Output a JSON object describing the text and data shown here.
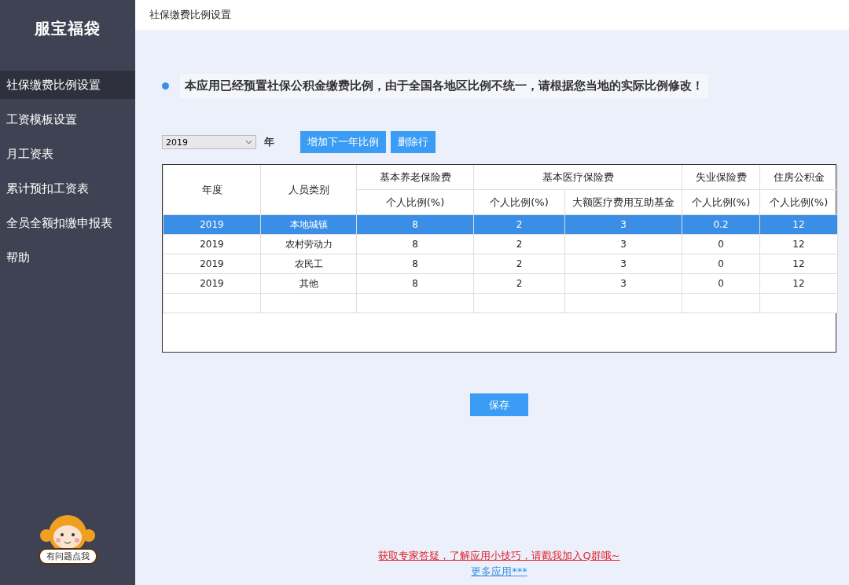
{
  "sidebar": {
    "logo": "服宝福袋",
    "items": [
      {
        "label": "社保缴费比例设置",
        "selected": true
      },
      {
        "label": "工资模板设置",
        "selected": false
      },
      {
        "label": "月工资表",
        "selected": false
      },
      {
        "label": "累计预扣工资表",
        "selected": false
      },
      {
        "label": "全员全额扣缴申报表",
        "selected": false
      },
      {
        "label": "帮助",
        "selected": false
      }
    ],
    "help_badge": "有问题点我"
  },
  "page_title": "社保缴费比例设置",
  "notice": "本应用已经预置社保公积金缴费比例，由于全国各地区比例不统一，请根据您当地的实际比例修改！",
  "toolbar": {
    "year_select": {
      "value": "2019"
    },
    "year_label": "年",
    "buttons": [
      "增加下一年比例",
      "删除行"
    ]
  },
  "table": {
    "header_rows": [
      [
        {
          "label": "年度",
          "rowspan": 2
        },
        {
          "label": "人员类别",
          "rowspan": 2
        },
        {
          "label": "基本养老保险费"
        },
        {
          "label": "基本医疗保险费",
          "colspan": 2
        },
        {
          "label": "失业保险费"
        },
        {
          "label": "住房公积金"
        }
      ],
      [
        {
          "label": "个人比例(%)"
        },
        {
          "label": "个人比例(%)"
        },
        {
          "label": "大额医疗费用互助基金"
        },
        {
          "label": "个人比例(%)"
        },
        {
          "label": "个人比例(%)"
        }
      ]
    ],
    "rows": [
      {
        "selected": true,
        "cells": [
          "2019",
          "本地城镇",
          "8",
          "2",
          "3",
          "0.2",
          "12"
        ]
      },
      {
        "selected": false,
        "cells": [
          "2019",
          "农村劳动力",
          "8",
          "2",
          "3",
          "0",
          "12"
        ]
      },
      {
        "selected": false,
        "cells": [
          "2019",
          "农民工",
          "8",
          "2",
          "3",
          "0",
          "12"
        ]
      },
      {
        "selected": false,
        "cells": [
          "2019",
          "其他",
          "8",
          "2",
          "3",
          "0",
          "12"
        ]
      }
    ]
  },
  "save_button": "保存",
  "footer_links": [
    {
      "label": "获取专家答疑，了解应用小技巧，请戳我加入Q群哦~",
      "kind": "promo"
    },
    {
      "label": "更多应用***",
      "kind": "more"
    }
  ]
}
